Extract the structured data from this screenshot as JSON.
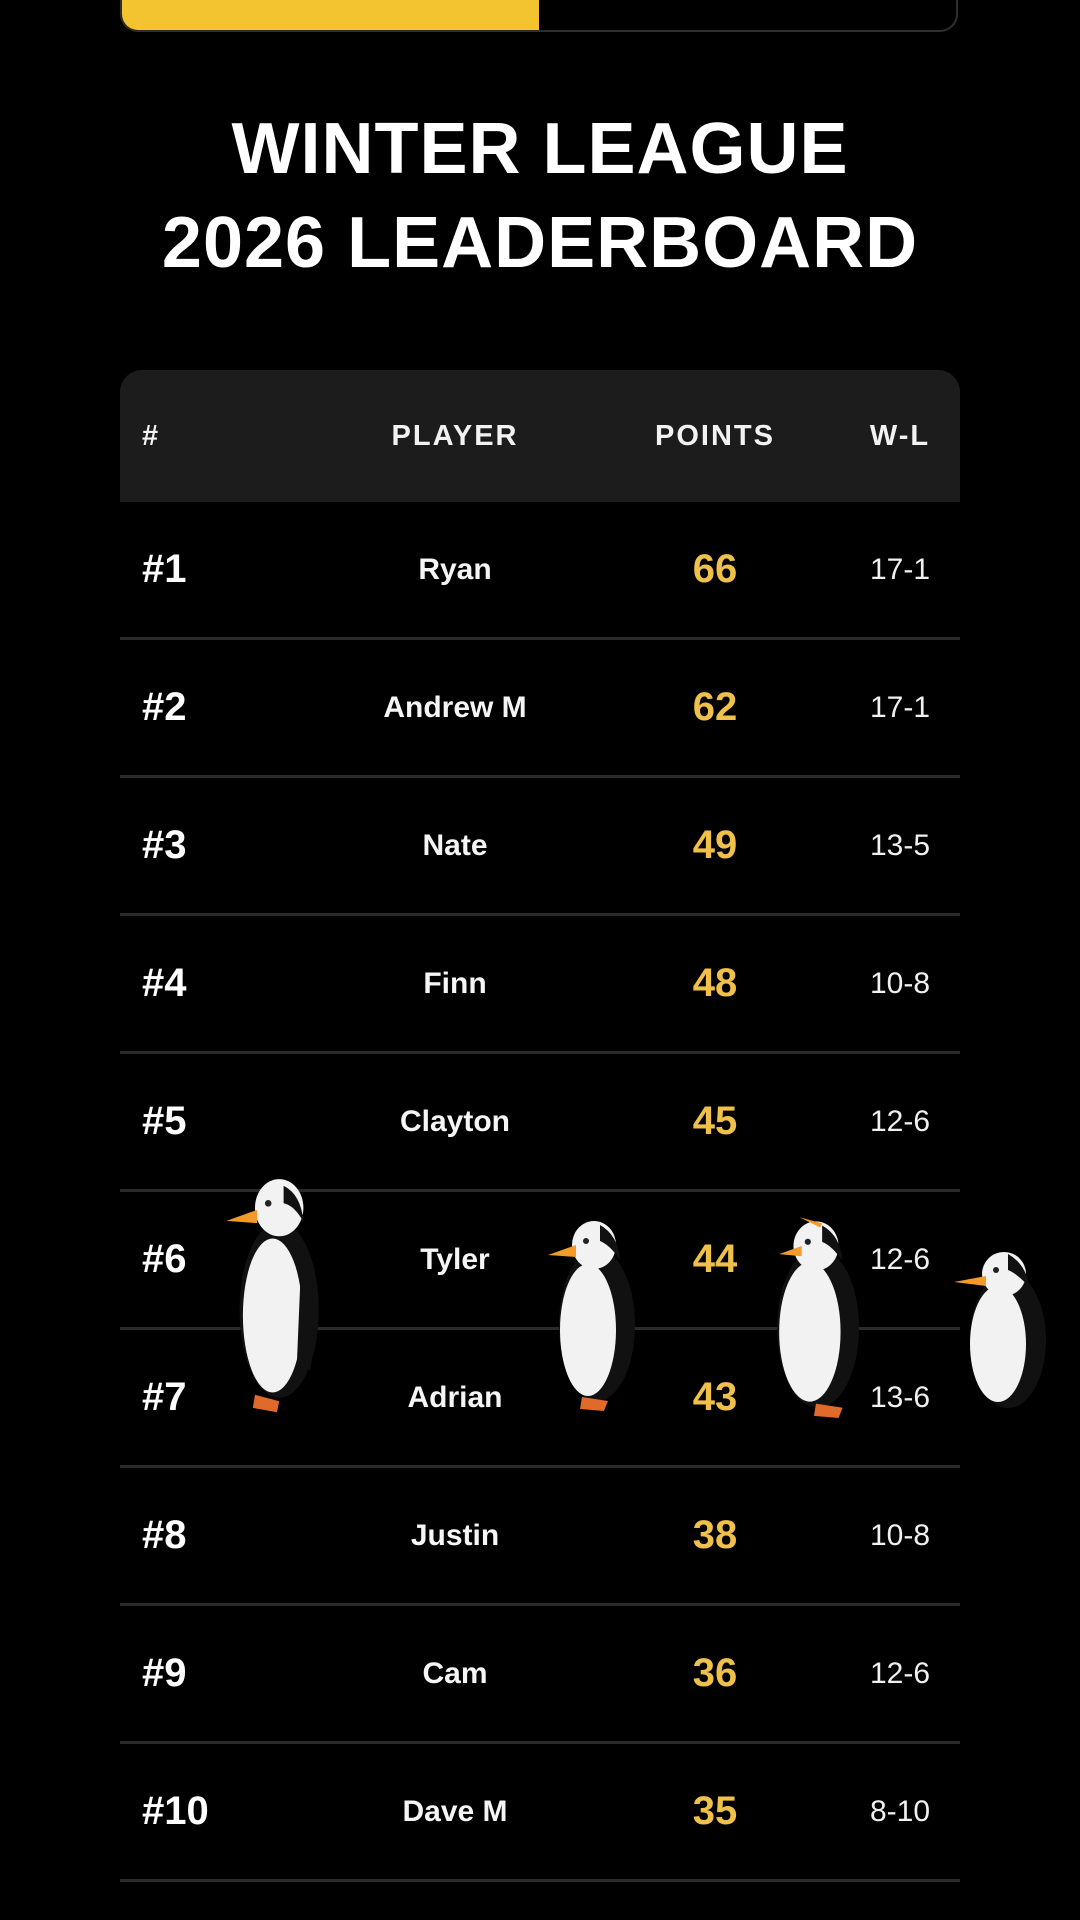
{
  "progress": {
    "fraction": 0.5,
    "color": "#f4c430"
  },
  "title": {
    "line1": "WINTER LEAGUE",
    "line2": "2026 LEADERBOARD"
  },
  "table": {
    "headers": {
      "rank": "#",
      "player": "PLAYER",
      "points": "POINTS",
      "wl": "W-L"
    },
    "rows": [
      {
        "rank": "#1",
        "player": "Ryan",
        "points": "66",
        "wl": "17-1"
      },
      {
        "rank": "#2",
        "player": "Andrew M",
        "points": "62",
        "wl": "17-1"
      },
      {
        "rank": "#3",
        "player": "Nate",
        "points": "49",
        "wl": "13-5"
      },
      {
        "rank": "#4",
        "player": "Finn",
        "points": "48",
        "wl": "10-8"
      },
      {
        "rank": "#5",
        "player": "Clayton",
        "points": "45",
        "wl": "12-6"
      },
      {
        "rank": "#6",
        "player": "Tyler",
        "points": "44",
        "wl": "12-6"
      },
      {
        "rank": "#7",
        "player": "Adrian",
        "points": "43",
        "wl": "13-6"
      },
      {
        "rank": "#8",
        "player": "Justin",
        "points": "38",
        "wl": "10-8"
      },
      {
        "rank": "#9",
        "player": "Cam",
        "points": "36",
        "wl": "12-6"
      },
      {
        "rank": "#10",
        "player": "Dave M",
        "points": "35",
        "wl": "8-10"
      }
    ]
  },
  "colors": {
    "points": "#efc04a",
    "background": "#000000",
    "header_bg": "#1c1c1c"
  },
  "overlay": {
    "icon": "penguin-icon",
    "count": 4
  }
}
